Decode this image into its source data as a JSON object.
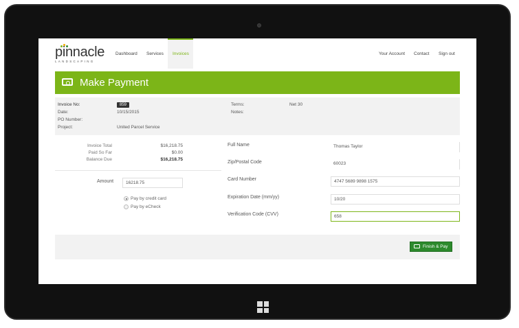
{
  "brand": {
    "name": "pinnacle",
    "tagline": "LANDSCAPING",
    "dot_colors": [
      "#7cb518",
      "#f2a900",
      "#2d8a2d"
    ]
  },
  "nav": {
    "left": [
      "Dashboard",
      "Services",
      "Invoices"
    ],
    "active": "Invoices",
    "right": [
      "Your Account",
      "Contact",
      "Sign out"
    ]
  },
  "header": {
    "title": "Make Payment",
    "icon": "money-icon"
  },
  "invoice": {
    "no_label": "Invoice No:",
    "no_value": "859",
    "date_label": "Date:",
    "date_value": "10/15/2015",
    "po_label": "PO Number:",
    "po_value": "",
    "project_label": "Project:",
    "project_value": "United Parcel Service",
    "terms_label": "Terms:",
    "terms_value": "Net 30",
    "notes_label": "Notes:",
    "notes_value": ""
  },
  "summary": {
    "total_label": "Invoice Total",
    "total_value": "$16,218.75",
    "paid_label": "Paid So Far",
    "paid_value": "$0.00",
    "balance_label": "Balance Due",
    "balance_value": "$16,218.75"
  },
  "amount": {
    "label": "Amount",
    "value": "16218.75"
  },
  "payment_method": {
    "options": [
      "Pay by credit card",
      "Pay by eCheck"
    ],
    "selected": "Pay by credit card"
  },
  "form": {
    "full_name_label": "Full Name",
    "full_name_value": "Thomas Taylor",
    "zip_label": "Zip/Postal Code",
    "zip_value": "60023",
    "card_label": "Card Number",
    "card_value": "4747 5689 9898 1575",
    "exp_label": "Expiration Date (mm/yy)",
    "exp_value": "10/20",
    "cvv_label": "Verification Code (CVV)",
    "cvv_value": "658"
  },
  "submit": {
    "label": "Finish & Pay"
  },
  "colors": {
    "accent": "#7cb518",
    "button": "#2d8a2d",
    "panel": "#f2f2f2"
  }
}
